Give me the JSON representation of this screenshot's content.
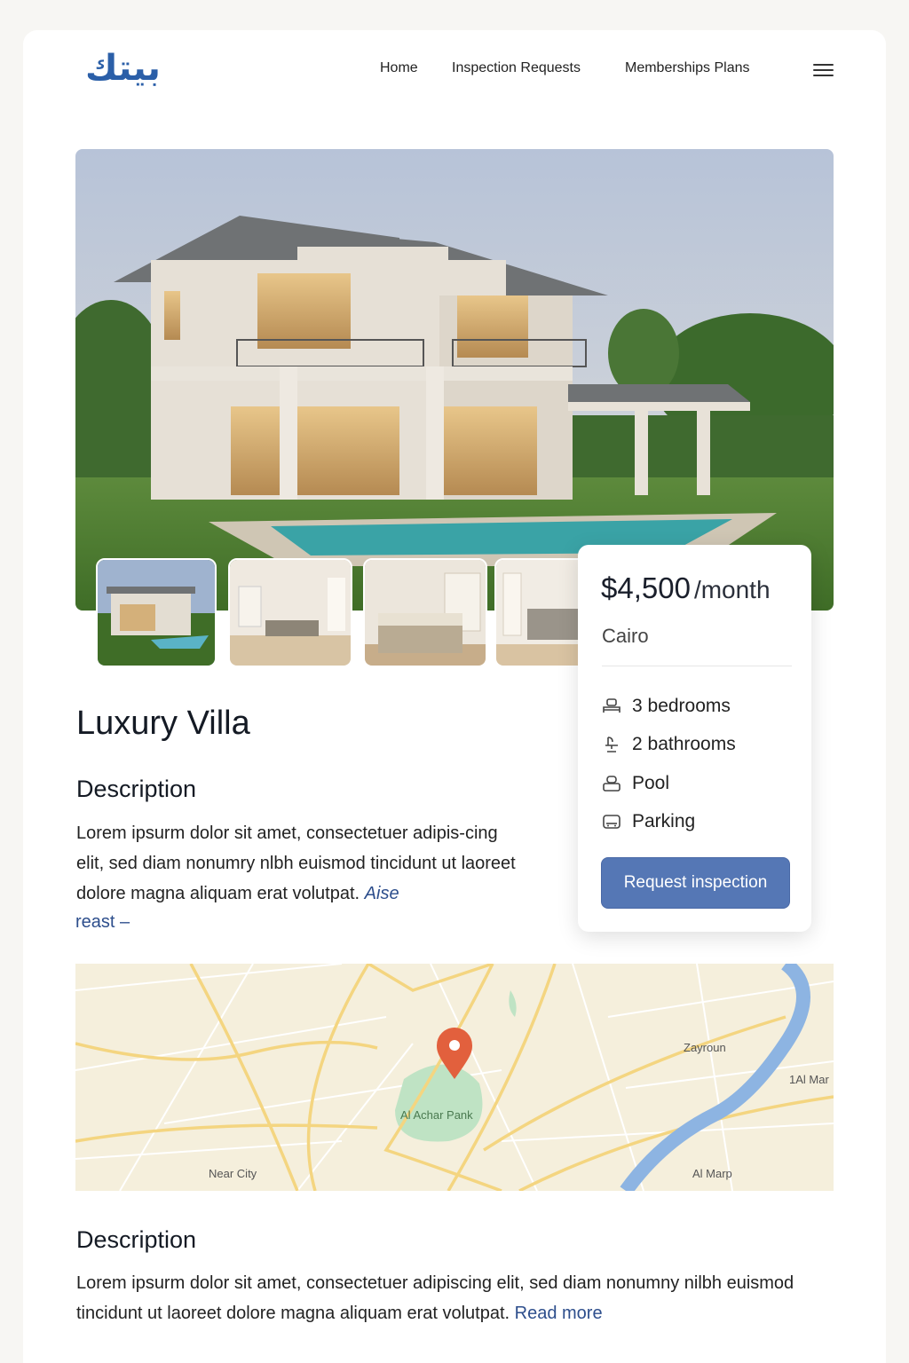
{
  "header": {
    "logo_text": "بيتك",
    "nav": [
      "Home",
      "Inspection Requests",
      "Memberships Plans"
    ]
  },
  "listing": {
    "title": "Luxury Villa",
    "price": "$4,500",
    "price_unit": "/month",
    "city": "Cairo",
    "features": [
      {
        "label": "3 bedrooms",
        "icon": "bed-icon"
      },
      {
        "label": "2 bathrooms",
        "icon": "bath-icon"
      },
      {
        "label": "Pool",
        "icon": "pool-icon"
      },
      {
        "label": "Parking",
        "icon": "parking-icon"
      }
    ],
    "cta": "Request inspection"
  },
  "description_section": {
    "heading": "Description",
    "text": "Lorem ipsurm dolor sit amet, consectetuer adipis-cing elit, sed diam nonumry nlbh euismod tincidunt ut laoreet dolore magna aliquam erat volutpat.",
    "text_highlight": "Aise",
    "read_more": "reast –"
  },
  "map": {
    "labels": [
      "Zayroun",
      "1Al Mar",
      "Al Achar Pank",
      "Near City",
      "Al Marp"
    ]
  },
  "description_section_2": {
    "heading": "Description",
    "text": "Lorem ipsurm dolor sit amet, consectetuer adipiscing elit, sed diam nonumny nilbh euismod tincidunt ut laoreet dolore magna aliquam erat volutpat.",
    "read_more": "Read more"
  },
  "colors": {
    "brand": "#2b5fa8",
    "button": "#5577b5",
    "link": "#2d4e8c",
    "map_pin": "#e2603d",
    "river": "#8db4e2",
    "road": "#f4d580"
  }
}
